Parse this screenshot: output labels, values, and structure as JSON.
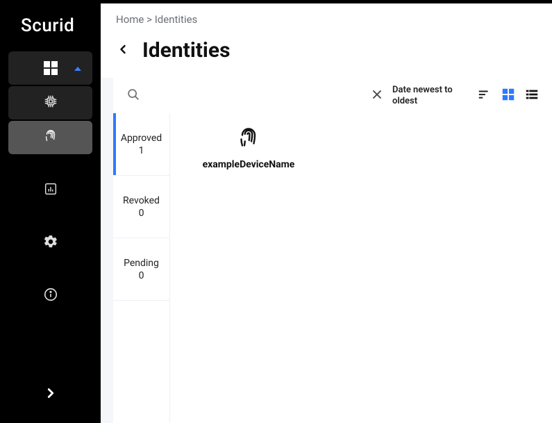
{
  "app": {
    "brand": "Scurid"
  },
  "breadcrumb": {
    "home": "Home",
    "sep": ">",
    "current": "Identities"
  },
  "page": {
    "title": "Identities"
  },
  "toolbar": {
    "search_value": "",
    "search_placeholder": "",
    "sort_label": "Date newest to oldest"
  },
  "status": {
    "items": [
      {
        "label": "Approved",
        "count": "1"
      },
      {
        "label": "Revoked",
        "count": "0"
      },
      {
        "label": "Pending",
        "count": "0"
      }
    ]
  },
  "cards": {
    "items": [
      {
        "name": "exampleDeviceName"
      }
    ]
  }
}
